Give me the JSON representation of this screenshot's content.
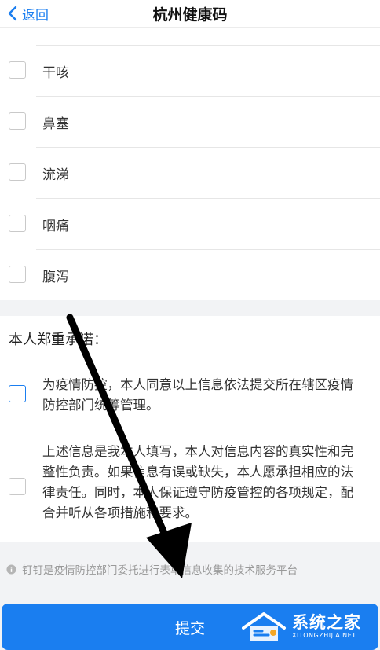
{
  "header": {
    "back_label": "返回",
    "title": "杭州健康码"
  },
  "symptoms": [
    {
      "label": "干咳",
      "checked": false
    },
    {
      "label": "鼻塞",
      "checked": false
    },
    {
      "label": "流涕",
      "checked": false
    },
    {
      "label": "咽痛",
      "checked": false
    },
    {
      "label": "腹泻",
      "checked": false
    }
  ],
  "pledge": {
    "title": "本人郑重承诺：",
    "items": [
      {
        "text": "为疫情防控，本人同意以上信息依法提交所在辖区疫情防控部门统筹管理。",
        "checked": false
      },
      {
        "text": "上述信息是我本人填写，本人对信息内容的真实性和完整性负责。如果信息有误或缺失，本人愿承担相应的法律责任。同时，本人保证遵守防疫管控的各项规定，配合并听从各项措施和要求。",
        "checked": false
      }
    ]
  },
  "notice": {
    "text": "钉钉是疫情防控部门委托进行表单信息收集的技术服务平台",
    "icon": "info-circle-icon"
  },
  "submit": {
    "label": "提交"
  },
  "watermark": {
    "cn": "系统之家",
    "en": "XITONGZHIJIA.NET"
  },
  "colors": {
    "accent": "#1a7ef0",
    "background_gray": "#f2f3f5",
    "text": "#333333",
    "muted": "#999999",
    "annotation_arrow": "#000000"
  }
}
